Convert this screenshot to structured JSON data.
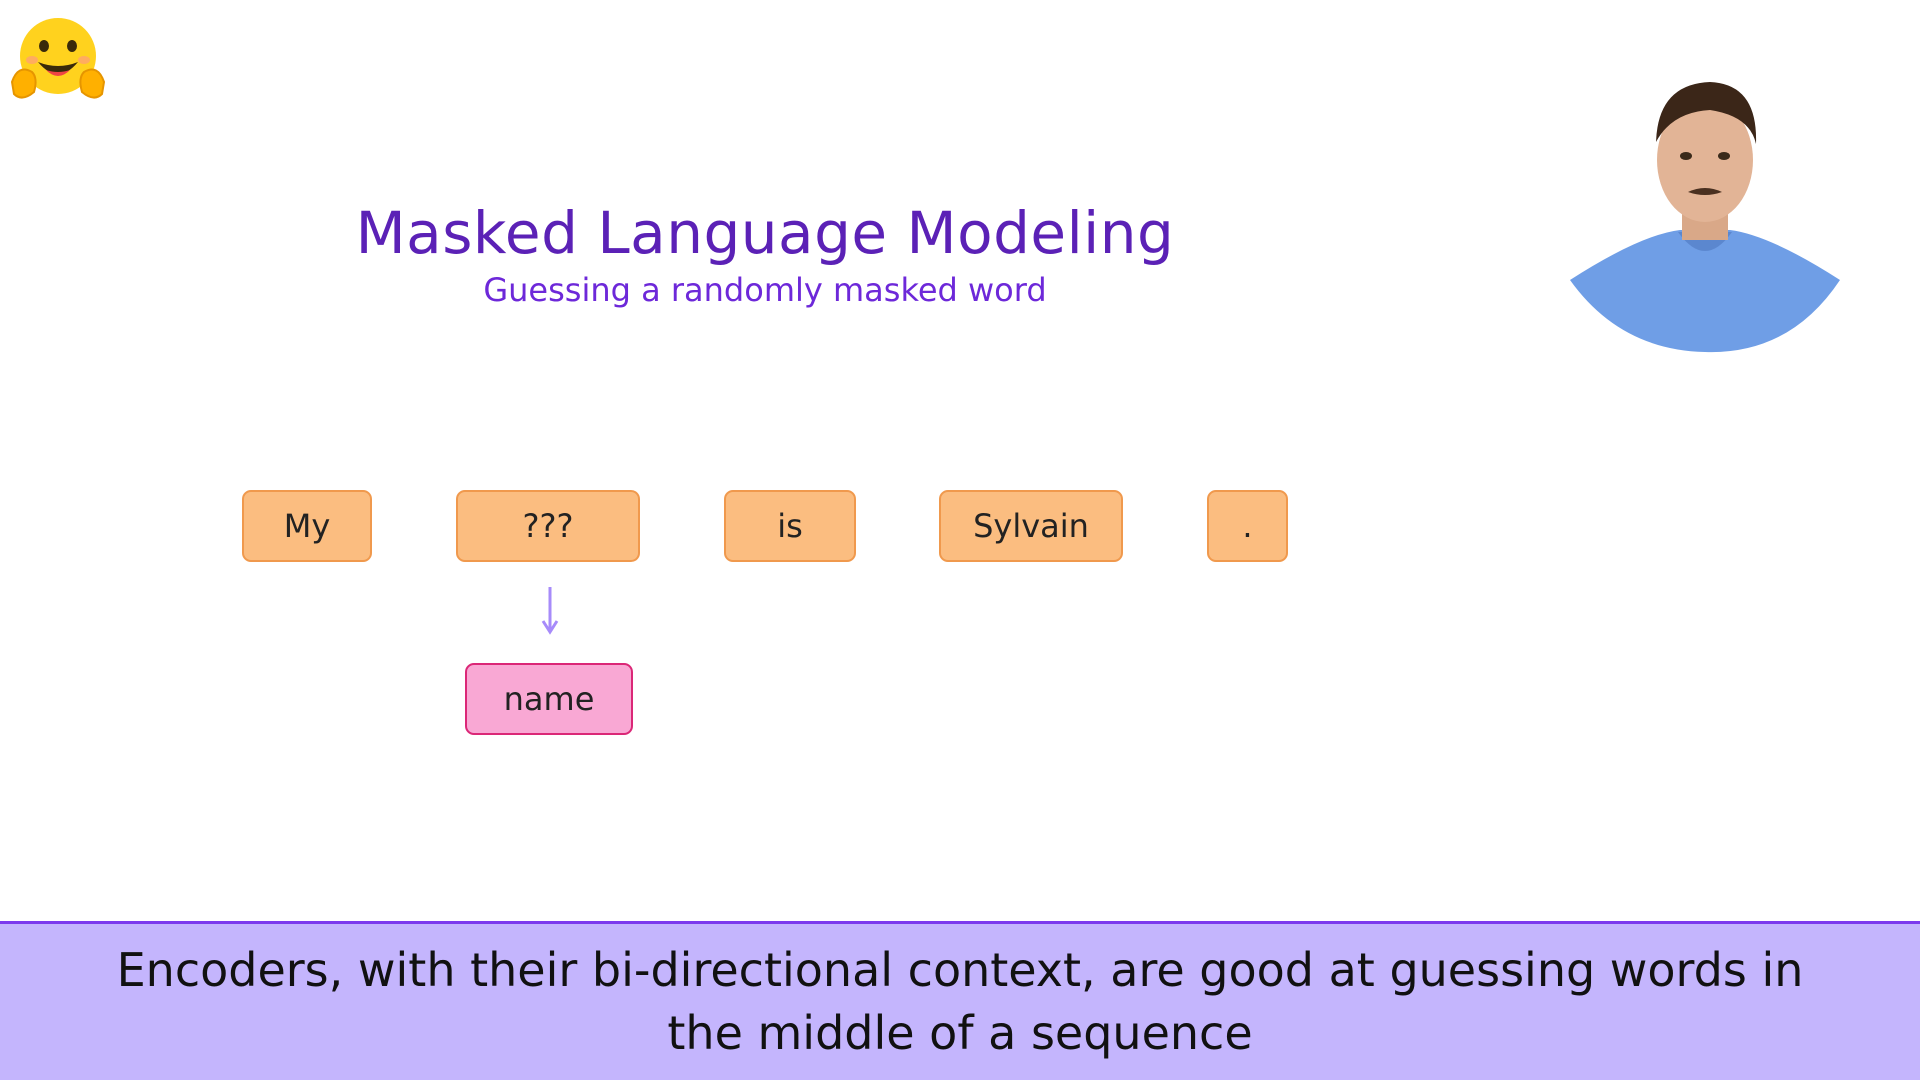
{
  "slide": {
    "title": "Masked Language Modeling",
    "subtitle": "Guessing a randomly masked word"
  },
  "tokens": [
    "My",
    "???",
    "is",
    "Sylvain",
    "."
  ],
  "prediction": "name",
  "caption": "Encoders, with their bi-directional context, are good at guessing words in the middle of a sequence",
  "icons": {
    "logo": "hugging-face-emoji-icon",
    "arrow": "arrow-down-icon"
  },
  "colors": {
    "title": "#5b21b6",
    "token_fill": "#fbbd80",
    "token_border": "#f0994d",
    "prediction_fill": "#f9a8d4",
    "prediction_border": "#db2777",
    "caption_bar": "#c4b5fd"
  }
}
